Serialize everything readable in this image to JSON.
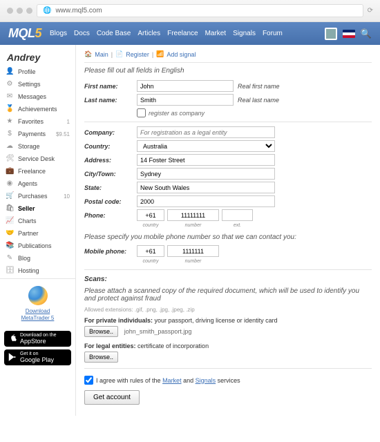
{
  "browser": {
    "url": "www.mql5.com"
  },
  "nav": {
    "logo": "MQL",
    "logo_num": "5",
    "items": [
      "Blogs",
      "Docs",
      "Code Base",
      "Articles",
      "Freelance",
      "Market",
      "Signals",
      "Forum"
    ]
  },
  "page_title": "Andrey",
  "sidebar": [
    {
      "ico": "👤",
      "label": "Profile"
    },
    {
      "ico": "⚙",
      "label": "Settings"
    },
    {
      "ico": "✉",
      "label": "Messages"
    },
    {
      "ico": "🏅",
      "label": "Achievements"
    },
    {
      "ico": "★",
      "label": "Favorites",
      "badge": "1"
    },
    {
      "ico": "$",
      "label": "Payments",
      "badge": "$9.51"
    },
    {
      "ico": "☁",
      "label": "Storage"
    },
    {
      "ico": "🛠",
      "label": "Service Desk"
    },
    {
      "ico": "💼",
      "label": "Freelance"
    },
    {
      "ico": "◉",
      "label": "Agents"
    },
    {
      "ico": "🛒",
      "label": "Purchases",
      "badge": "10"
    },
    {
      "ico": "🛍",
      "label": "Seller",
      "active": true
    },
    {
      "ico": "📈",
      "label": "Charts"
    },
    {
      "ico": "🤝",
      "label": "Partner"
    },
    {
      "ico": "📚",
      "label": "Publications"
    },
    {
      "ico": "✎",
      "label": "Blog"
    },
    {
      "ico": "🗄",
      "label": "Hosting"
    }
  ],
  "promo": {
    "link1": "Download",
    "link2": "MetaTrader 5"
  },
  "store1": {
    "l1": "Download on the",
    "l2": "AppStore"
  },
  "store2": {
    "l1": "Get it on",
    "l2": "Google Play"
  },
  "breadcrumb": {
    "main": "Main",
    "register": "Register",
    "add": "Add signal"
  },
  "hints": {
    "fill": "Please fill out all fields in English",
    "mobile": "Please specify you mobile phone number so that we can contact you:",
    "scans": "Please attach a scanned copy of the required document, which will be used to identify you and protect against fraud",
    "allowed": "Allowed extensions: .gif, .png, .jpg, .jpeg, .zip"
  },
  "labels": {
    "first": "First name:",
    "last": "Last name:",
    "company": "Company:",
    "country": "Country:",
    "address": "Address:",
    "city": "City/Town:",
    "state": "State:",
    "postal": "Postal code:",
    "phone": "Phone:",
    "mobile": "Mobile phone:",
    "scans": "Scans:"
  },
  "notes": {
    "first": "Real first name",
    "last": "Real last name",
    "reg_company": "register as company"
  },
  "values": {
    "first": "John",
    "last": "Smith",
    "company_ph": "For registration as a legal entity",
    "country": "Australia",
    "address": "14 Foster Street",
    "city": "Sydney",
    "state": "New South Wales",
    "postal": "2000",
    "ph_cc": "+61",
    "ph_num": "11111111",
    "ph_ext": "",
    "mb_cc": "+61",
    "mb_num": "1111111"
  },
  "phone_sub": {
    "country": "country",
    "number": "number",
    "ext": "ext."
  },
  "files": {
    "priv_label_b": "For private individuals:",
    "priv_label": " your passport, driving license or identity card",
    "legal_label_b": "For legal entities:",
    "legal_label": " certificate of incorporation",
    "browse": "Browse..",
    "filename": "john_smith_passport.jpg"
  },
  "agree": {
    "pre": "I agree with rules of the ",
    "market": "Market",
    "mid": " and ",
    "signals": "Signals",
    "post": " services"
  },
  "submit": "Get account"
}
